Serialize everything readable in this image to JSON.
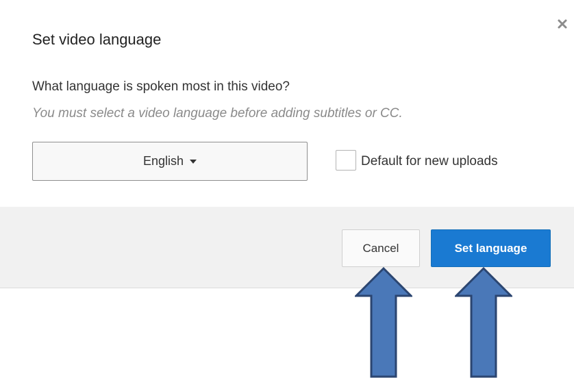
{
  "dialog": {
    "title": "Set video language",
    "question": "What language is spoken most in this video?",
    "note": "You must select a video language before adding subtitles or CC.",
    "close_icon": "close-icon",
    "language_select": {
      "selected": "English",
      "caret_icon": "caret-down-icon"
    },
    "default_checkbox": {
      "label": "Default for new uploads",
      "checked": false
    },
    "footer": {
      "cancel_label": "Cancel",
      "set_label": "Set language"
    }
  },
  "annotations": {
    "arrow_icon": "up-arrow-icon",
    "arrow_color": "#4a78b8",
    "arrow_border": "#2b4570"
  },
  "colors": {
    "primary": "#1a7ad2",
    "footer_bg": "#f1f1f1",
    "note_text": "#8a8a8a"
  }
}
